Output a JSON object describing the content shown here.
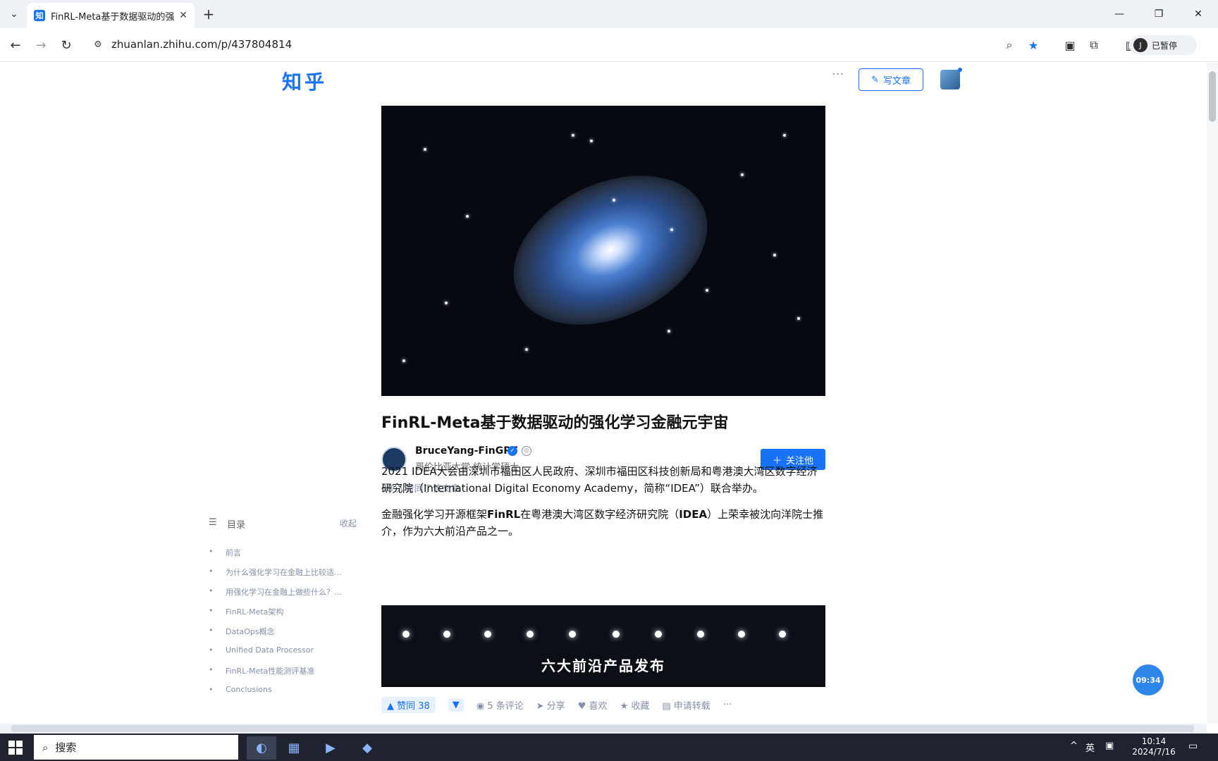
{
  "browser": {
    "tab_title": "FinRL-Meta基于数据驱动的强",
    "tab_favicon": "知",
    "url": "zhuanlan.zhihu.com/p/437804814",
    "profile_initial": "J",
    "profile_status": "已暂停"
  },
  "header": {
    "logo": "知乎",
    "more": "···",
    "write_label": "写文章"
  },
  "article": {
    "title": "FinRL-Meta基于数据驱动的强化学习金融元宇宙",
    "author_name": "BruceYang-FinGPT",
    "author_bio": "哥伦比亚大学 统计学硕士",
    "follow_label": "关注他",
    "likes_line": "38 人赞同了该文章",
    "para1": "2021 IDEA大会由深圳市福田区人民政府、深圳市福田区科技创新局和粤港澳大湾区数字经济研究院（International Digital Economy Academy，简称“IDEA”）联合举办。",
    "para2_prefix": "金融强化学习开源框架",
    "para2_bold1": "FinRL",
    "para2_mid": "在粤港澳大湾区数字经济研究院（",
    "para2_bold2": "IDEA",
    "para2_suffix": "）上荣幸被沈向洋院士推介，作为六大前沿产品之一。",
    "video_caption": "六大前沿产品发布"
  },
  "actions": {
    "upvote": "▲ 赞同 38",
    "downvote": "▼",
    "comments": "5 条评论",
    "share": "分享",
    "like": "喜欢",
    "favorite": "收藏",
    "license": "申请转载",
    "more": "···"
  },
  "toc": {
    "title": "目录",
    "collapse": "收起",
    "items": [
      "前言",
      "为什么强化学习在金融上比较适...",
      "用强化学习在金融上做些什么？...",
      "FinRL-Meta架构",
      "DataOps概念",
      "Unified Data Processor",
      "FinRL-Meta性能测评基准",
      "Conclusions"
    ]
  },
  "timer": "09:34",
  "taskbar": {
    "search_placeholder": "搜索",
    "ime": "英",
    "time": "10:14",
    "date": "2024/7/16"
  },
  "colors": {
    "brand": "#1772f6",
    "taskbar": "#1f2330"
  }
}
